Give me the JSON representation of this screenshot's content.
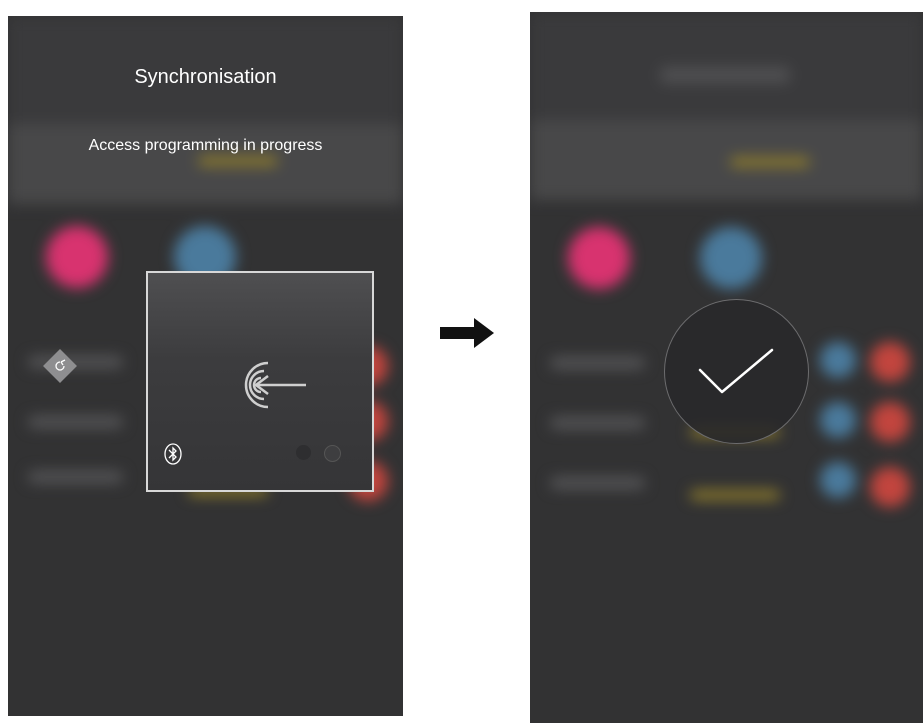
{
  "left_screen": {
    "title": "Synchronisation",
    "subtitle": "Access programming in progress",
    "device_panel": {
      "icons": [
        "bluetooth-icon",
        "access-target-icon"
      ],
      "indicator_dots": 2
    },
    "side_button_icon": "sync-arrow-icon"
  },
  "transition_icon": "right-arrow-icon",
  "right_screen": {
    "status_icon": "checkmark-icon"
  },
  "colors": {
    "background": "#323233",
    "accent_pink": "#d8336f",
    "accent_blue": "#4a7a9c",
    "accent_red": "#c2453e",
    "accent_yellow": "#c8a72c"
  }
}
